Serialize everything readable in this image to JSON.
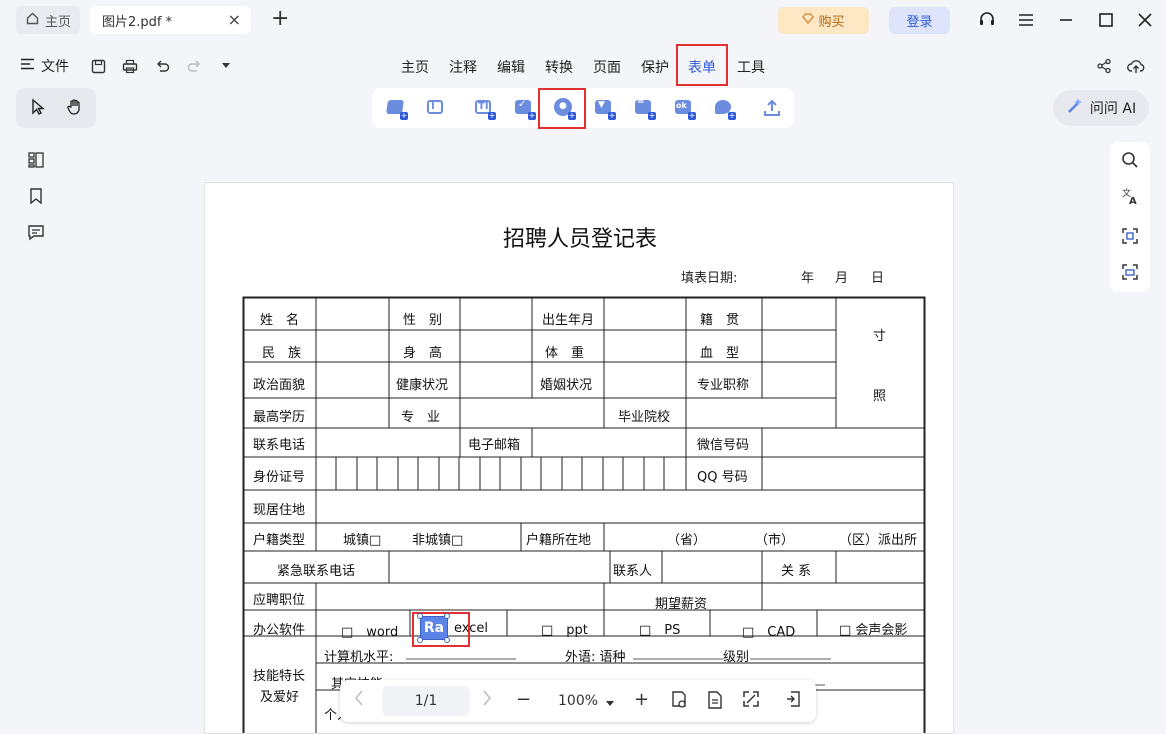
{
  "titlebar": {
    "home_tab": "主页",
    "file_tab": "图片2.pdf *",
    "close_symbol": "×",
    "new_tab_symbol": "+",
    "buy_label": "购买",
    "login_label": "登录"
  },
  "menubar": {
    "file_label": "文件",
    "items": [
      "主页",
      "注释",
      "编辑",
      "转换",
      "页面",
      "保护",
      "表单",
      "工具"
    ],
    "active_item": "表单"
  },
  "form_tools": [
    "text-field-icon",
    "text-box-icon",
    "ti-icon",
    "checkbox-icon",
    "radio-button-icon",
    "dropdown-icon",
    "list-box-icon",
    "ok-button-icon",
    "signature-icon",
    "upload-icon"
  ],
  "ask_ai_label": "问问 AI",
  "document": {
    "title": "招聘人员登记表",
    "fill_date_label": "填表日期:",
    "year": "年",
    "month": "月",
    "day": "日",
    "labels": {
      "name": "姓　名",
      "gender": "性　别",
      "birth": "出生年月",
      "native": "籍　贯",
      "cun": "寸",
      "ethnic": "民　族",
      "height": "身　高",
      "weight": "体　重",
      "blood": "血　型",
      "politics": "政治面貌",
      "health": "健康状况",
      "marriage": "婚姻状况",
      "title_prof": "专业职称",
      "zhao": "照",
      "education": "最高学历",
      "major": "专　业",
      "school": "毕业院校",
      "phone": "联系电话",
      "email": "电子邮箱",
      "wechat": "微信号码",
      "idcard": "身份证号",
      "qq": "QQ 号码",
      "address": "现居住地",
      "hukou_type": "户籍类型",
      "urban": "城镇□",
      "rural": "非城镇□",
      "hukou_place": "户籍所在地",
      "province": "（省）",
      "city": "（市）",
      "district": "（区）派出所",
      "emergency_phone": "紧急联系电话",
      "contact": "联系人",
      "relation": "关 系",
      "position": "应聘职位",
      "salary": "期望薪资",
      "office_software": "办公软件",
      "word": "□　word",
      "excel": "excel",
      "ppt": "□　ppt",
      "ps": "□　PS",
      "cad": "□　CAD",
      "audio": "□ 会声会影",
      "skills": "技能特长",
      "hobbies": "及爱好",
      "computer_level": "计算机水平:",
      "language": "外语: 语种",
      "grade": "级别",
      "other_skills": "其它技能:",
      "personal": "个人"
    },
    "rich_text_field": "Ra"
  },
  "bottom_bar": {
    "page_indicator": "1/1",
    "zoom": "100%",
    "minus": "−",
    "plus": "+"
  }
}
